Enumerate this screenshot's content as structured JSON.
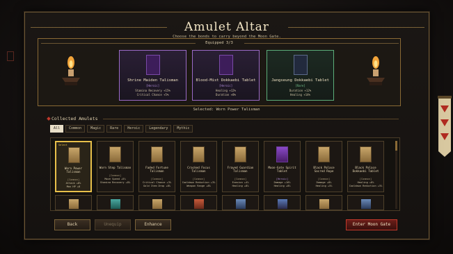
{
  "title": "Amulet Altar",
  "subtitle": "Choose the bonds to carry beyond the Moon Gate.",
  "equipped": {
    "label": "Equipped 3/3",
    "cards": [
      {
        "name": "Shrine Maiden Talisman",
        "rarity": "[Heroic]",
        "stats": [
          "Stamina Recovery +15%",
          "Critical Chance +5%"
        ],
        "color": "#9b6ac8"
      },
      {
        "name": "Blood-Mist Dokkaebi Tablet",
        "rarity": "[Heroic]",
        "stats": [
          "Healing +12%",
          "Duration +8%"
        ],
        "color": "#9b6ac8"
      },
      {
        "name": "Jangseung Dokkaebi Tablet",
        "rarity": "[Rare]",
        "stats": [
          "Duration +12%",
          "Healing +14%"
        ],
        "color": "#5cae7a"
      }
    ]
  },
  "selected_text": "Selected: Worn Power Talisman",
  "collected": {
    "label": "Collected Amulets",
    "tabs": [
      "All",
      "Common",
      "Magic",
      "Rare",
      "Heroic",
      "Legendary",
      "Mythic"
    ],
    "active_tab": "All",
    "cards": [
      {
        "badge": "Select",
        "name": "Worn Power Talisman",
        "rarity": "[Common]",
        "stats": [
          "Attack +8%",
          "Max HP +8"
        ],
        "purple": false
      },
      {
        "badge": "",
        "name": "Worn Step Talisman",
        "rarity": "[Common]",
        "stats": [
          "Move Speed +5%",
          "Stamina Recovery +8%"
        ],
        "purple": false
      },
      {
        "badge": "",
        "name": "Faded Fortune Talisman",
        "rarity": "[Common]",
        "stats": [
          "Critical Chance +3%",
          "Gold Item Drop +8%"
        ],
        "purple": false
      },
      {
        "badge": "",
        "name": "Cracked Focus Talisman",
        "rarity": "[Common]",
        "stats": [
          "Cooldown Reduction +3%",
          "Weapon Range +8%"
        ],
        "purple": false
      },
      {
        "badge": "",
        "name": "Frayed Guardian Talisman",
        "rarity": "[Common]",
        "stats": [
          "Evasion +4%",
          "Healing +8%"
        ],
        "purple": false
      },
      {
        "badge": "",
        "name": "Moon-Gate Spirit Tablet",
        "rarity": "[Heroic]",
        "stats": [
          "Damage +16%",
          "Healing +8%"
        ],
        "purple": true
      },
      {
        "badge": "",
        "name": "Black Palace Sacred Rope",
        "rarity": "[Common]",
        "stats": [
          "Damage +8%",
          "Healing +5%"
        ],
        "purple": false
      },
      {
        "badge": "",
        "name": "Black Palace Dokkaebi Tablet",
        "rarity": "[Common]",
        "stats": [
          "Healing +8%",
          "Cooldown Reduction +5%"
        ],
        "purple": false
      }
    ]
  },
  "buttons": {
    "back": "Back",
    "unequip": "Unequip",
    "enhance": "Enhance",
    "enter": "Enter Moon Gate"
  }
}
